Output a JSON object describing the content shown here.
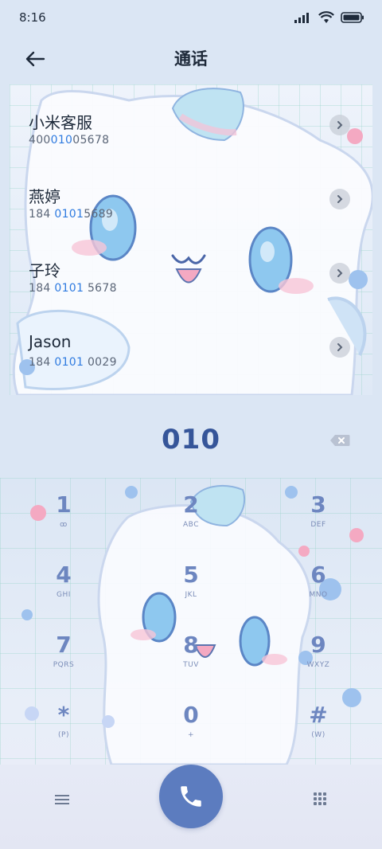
{
  "status_bar": {
    "time": "8:16"
  },
  "header": {
    "title": "通话"
  },
  "contacts": [
    {
      "name": "小米客服",
      "number_parts": [
        "400",
        "010",
        "05678"
      ]
    },
    {
      "name": "燕婷",
      "number_parts": [
        "184 ",
        "0101",
        "5689"
      ]
    },
    {
      "name": "子玲",
      "number_parts": [
        "184 ",
        "0101",
        " 5678"
      ]
    },
    {
      "name": "Jason",
      "number_parts": [
        "184 ",
        "0101",
        " 0029"
      ]
    }
  ],
  "dialer": {
    "dialed_number": "010"
  },
  "keypad": [
    {
      "digit": "1",
      "letters": "ꝏ"
    },
    {
      "digit": "2",
      "letters": "ABC"
    },
    {
      "digit": "3",
      "letters": "DEF"
    },
    {
      "digit": "4",
      "letters": "GHI"
    },
    {
      "digit": "5",
      "letters": "JKL"
    },
    {
      "digit": "6",
      "letters": "MNO"
    },
    {
      "digit": "7",
      "letters": "PQRS"
    },
    {
      "digit": "8",
      "letters": "TUV"
    },
    {
      "digit": "9",
      "letters": "WXYZ"
    },
    {
      "digit": "*",
      "letters": "(P)"
    },
    {
      "digit": "0",
      "letters": "+"
    },
    {
      "digit": "#",
      "letters": "(W)"
    }
  ],
  "icons": {
    "back": "arrow-left-icon",
    "backspace": "backspace-icon",
    "menu": "menu-icon",
    "call": "phone-icon",
    "keypad": "dialpad-icon"
  },
  "colors": {
    "accent": "#5c7cbf",
    "highlight": "#2f7be0",
    "digit": "#6d86c0"
  }
}
